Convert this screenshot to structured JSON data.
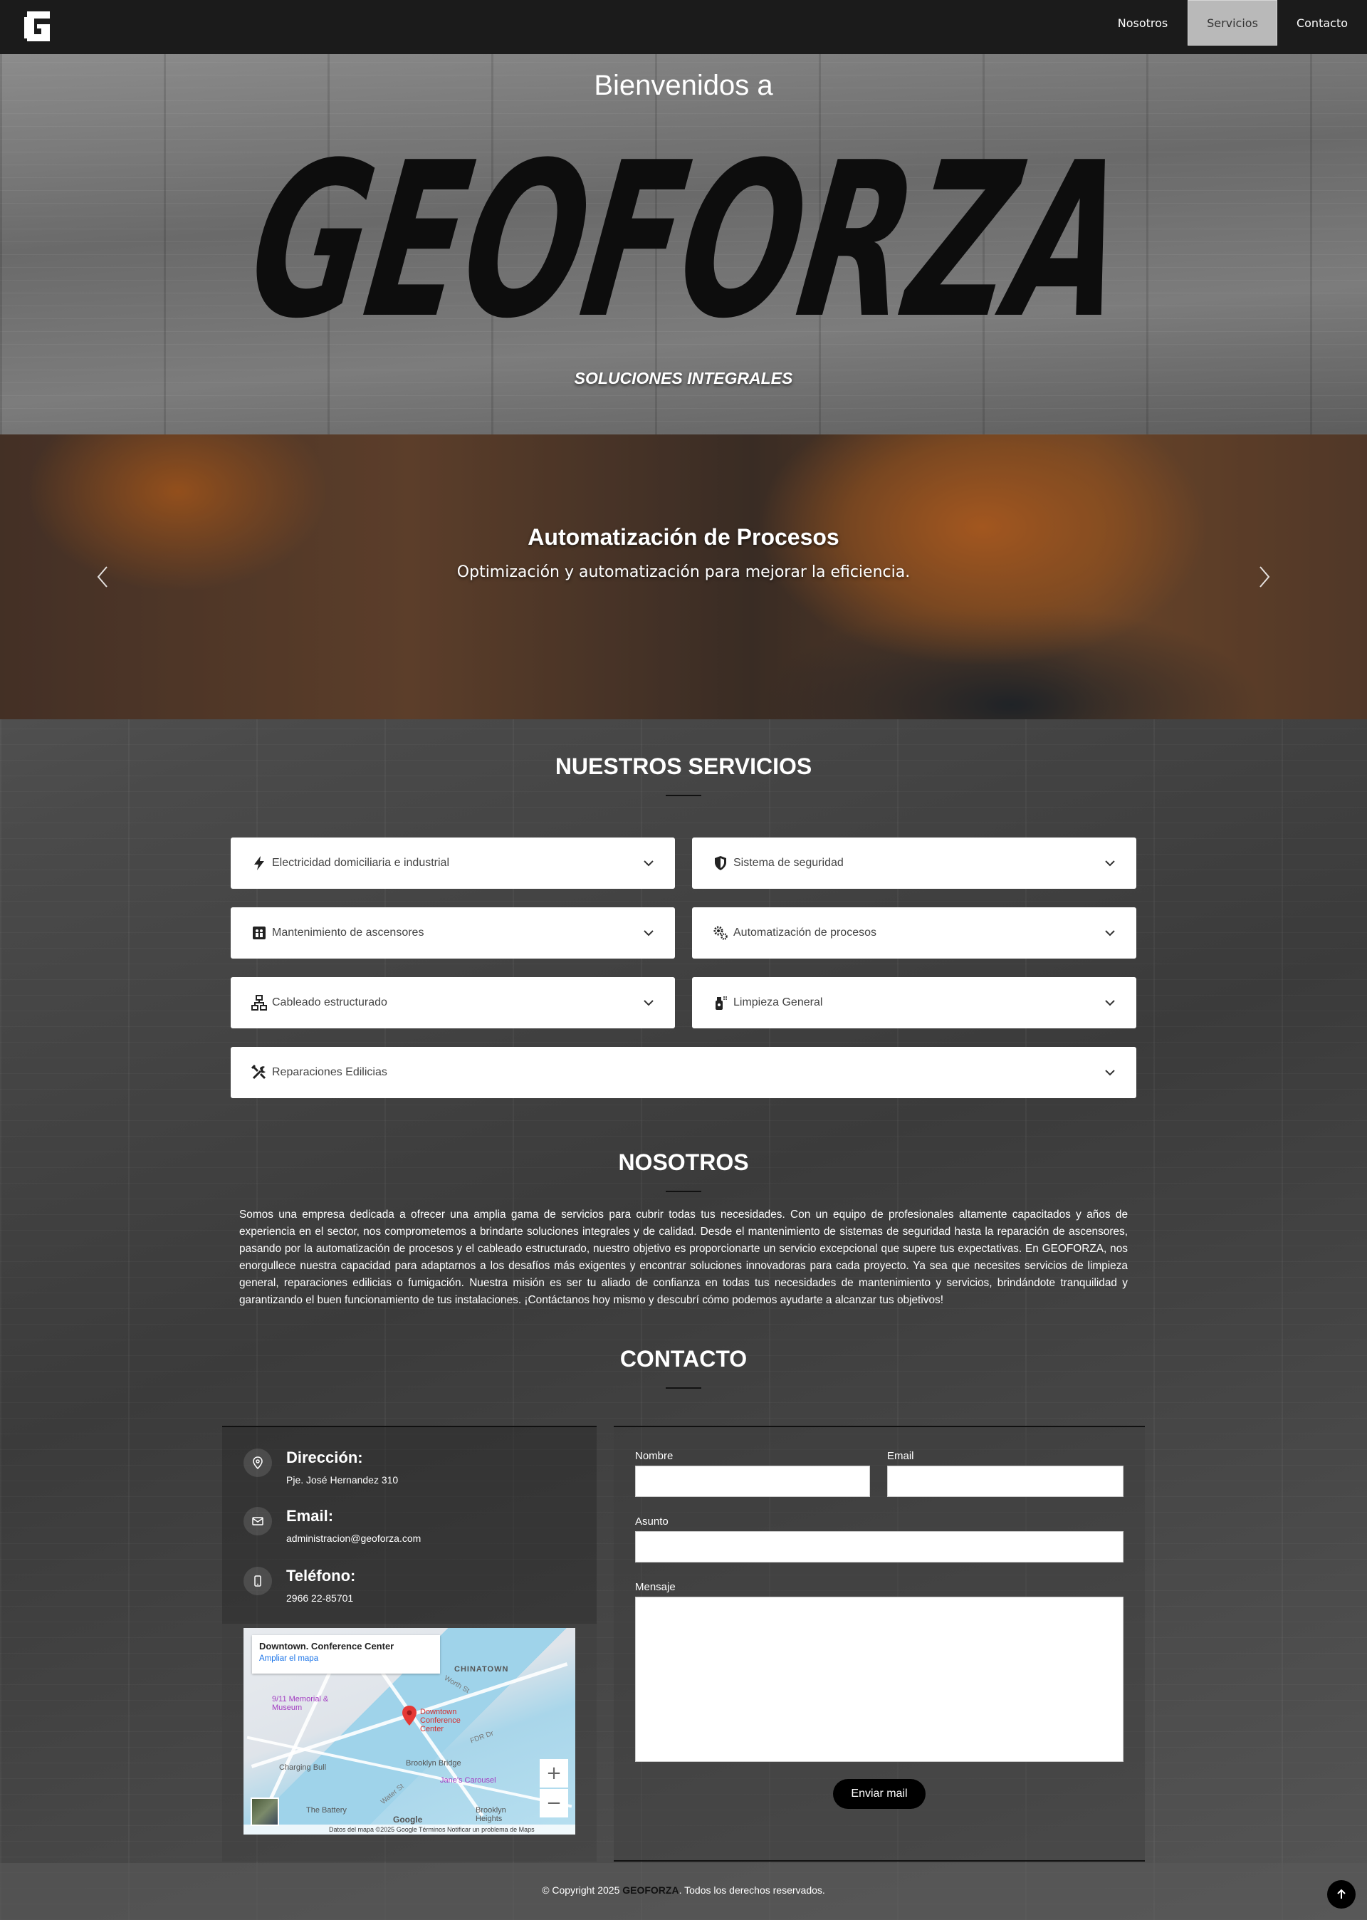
{
  "nav": {
    "items": [
      {
        "label": "Nosotros",
        "active": false
      },
      {
        "label": "Servicios",
        "active": true
      },
      {
        "label": "Contacto",
        "active": false
      }
    ]
  },
  "hero": {
    "welcome": "Bienvenidos a",
    "brand": "GEOFORZA",
    "tagline": "SOLUCIONES INTEGRALES"
  },
  "carousel": {
    "title": "Automatización de Procesos",
    "text": "Optimización y automatización para mejorar la eficiencia."
  },
  "services": {
    "heading": "NUESTROS SERVICIOS",
    "items": [
      {
        "label": "Electricidad domiciliaria e industrial",
        "icon": "bolt-icon"
      },
      {
        "label": "Sistema de seguridad",
        "icon": "shield-icon"
      },
      {
        "label": "Mantenimiento de ascensores",
        "icon": "elevator-icon"
      },
      {
        "label": "Automatización de procesos",
        "icon": "gears-icon"
      },
      {
        "label": "Cableado estructurado",
        "icon": "network-icon"
      },
      {
        "label": "Limpieza General",
        "icon": "spray-bottle-icon"
      },
      {
        "label": "Reparaciones Edilicias",
        "icon": "tools-icon"
      }
    ]
  },
  "about": {
    "heading": "NOSOTROS",
    "text": "Somos una empresa dedicada a ofrecer una amplia gama de servicios para cubrir todas tus necesidades. Con un equipo de profesionales altamente capacitados y años de experiencia en el sector, nos comprometemos a brindarte soluciones integrales y de calidad. Desde el mantenimiento de sistemas de seguridad hasta la reparación de ascensores, pasando por la automatización de procesos y el cableado estructurado, nuestro objetivo es proporcionarte un servicio excepcional que supere tus expectativas. En GEOFORZA, nos enorgullece nuestra capacidad para adaptarnos a los desafíos más exigentes y encontrar soluciones innovadoras para cada proyecto. Ya sea que necesites servicios de limpieza general, reparaciones edilicias o fumigación. Nuestra misión es ser tu aliado de confianza en todas tus necesidades de mantenimiento y servicios, brindándote tranquilidad y garantizando el buen funcionamiento de tus instalaciones. ¡Contáctanos hoy mismo y descubrí cómo podemos ayudarte a alcanzar tus objetivos!"
  },
  "contact": {
    "heading": "CONTACTO",
    "address_title": "Dirección:",
    "address_value": "Pje. José Hernandez 310",
    "email_title": "Email:",
    "email_value": "administracion@geoforza.com",
    "phone_title": "Teléfono:",
    "phone_value": "2966 22-85701",
    "map": {
      "card_title": "Downtown. Conference Center",
      "card_link": "Ampliar el mapa",
      "labels": [
        "CHINATOWN",
        "9/11 Memorial & Museum",
        "Downtown Conference Center",
        "Charging Bull",
        "Brooklyn Bridge",
        "Jane's Carousel",
        "The Battery",
        "Brooklyn Heights",
        "Worth St",
        "FDR Dr",
        "Water St"
      ],
      "footer": "Datos del mapa ©2025 Google   Términos   Notificar un problema de Maps",
      "google": "Google"
    },
    "form": {
      "name_label": "Nombre",
      "email_label": "Email",
      "subject_label": "Asunto",
      "message_label": "Mensaje",
      "submit": "Enviar mail"
    }
  },
  "footer": {
    "prefix": "© Copyright 2025 ",
    "brand": "GEOFORZA",
    "suffix": ". Todos los derechos reservados."
  },
  "colors": {
    "navbar": "#1b1b1b",
    "active_nav": "#b9b9b9",
    "button": "#000000",
    "map_link": "#1a73e8"
  }
}
